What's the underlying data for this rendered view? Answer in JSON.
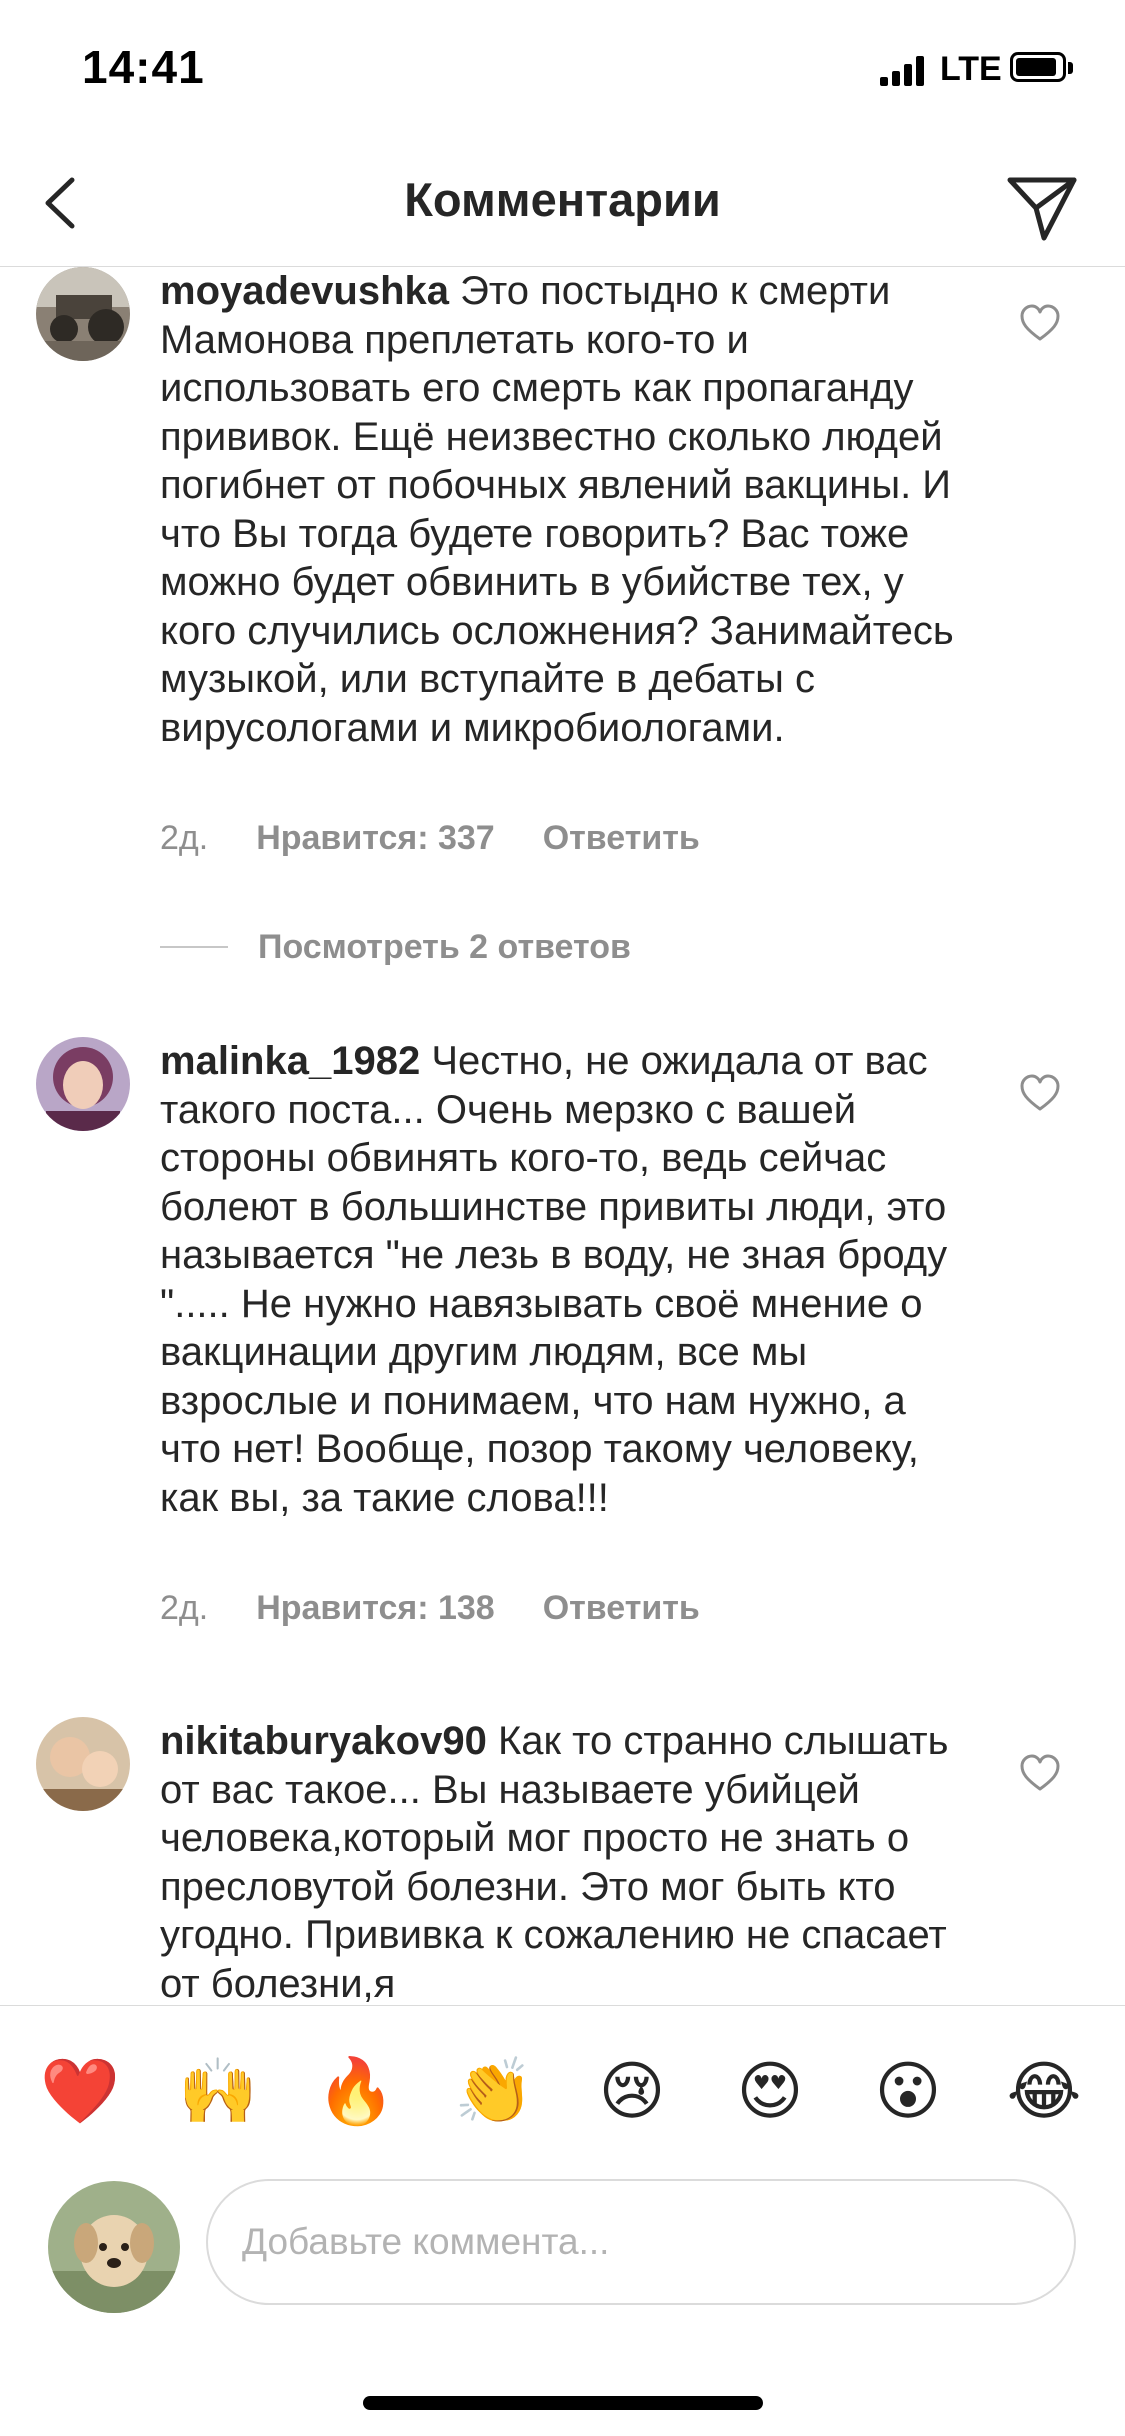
{
  "status": {
    "time": "14:41",
    "network": "LTE"
  },
  "header": {
    "title": "Комментарии"
  },
  "comments": [
    {
      "username": "moyadevushka",
      "text": "Это постыдно к смерти Мамонова преплетать кого-то и использовать его смерть как пропаганду прививок. Ещё неизвестно сколько людей погибнет от побочных явлений вакцины. И что Вы тогда будете говорить? Вас тоже можно будет обвинить в убийстве тех, у кого случились осложнения? Занимайтесь музыкой, или вступайте в дебаты с вирусологами и микробиологами.",
      "age": "2д.",
      "likes": "Нравится: 337",
      "reply": "Ответить",
      "view_replies": "Посмотреть 2 ответов"
    },
    {
      "username": "malinka_1982",
      "text": "Честно, не ожидала от вас такого поста... Очень мерзко с вашей стороны обвинять кого-то, ведь сейчас болеют в большинстве привиты люди, это называется \"не лезь в воду, не зная броду \"..... Не нужно навязывать своё мнение о вакцинации другим людям, все мы взрослые и понимаем, что нам нужно, а что нет! Вообще, позор такому человеку, как вы, за такие слова!!!",
      "age": "2д.",
      "likes": "Нравится: 138",
      "reply": "Ответить"
    },
    {
      "username": "nikitaburyakov90",
      "text": "Как то странно слышать от вас такое... Вы называете убийцей человека,который мог просто не знать о пресловутой болезни. Это мог быть кто угодно. Прививка к сожалению не спасает от болезни,я"
    }
  ],
  "emoji_bar": [
    {
      "glyph": "❤️",
      "name": "heart-emoji"
    },
    {
      "glyph": "🙌",
      "name": "raised-hands-emoji"
    },
    {
      "glyph": "🔥",
      "name": "fire-emoji"
    },
    {
      "glyph": "👏",
      "name": "clapping-hands-emoji"
    },
    {
      "glyph": "😢",
      "name": "crying-face-emoji"
    },
    {
      "glyph": "😍",
      "name": "heart-eyes-emoji"
    },
    {
      "glyph": "😮",
      "name": "surprised-face-emoji"
    },
    {
      "glyph": "😂",
      "name": "tears-of-joy-emoji"
    }
  ],
  "composer": {
    "placeholder": "Добавьте коммента..."
  },
  "icons": {
    "back": "chevron-left-icon",
    "send": "paper-plane-icon",
    "like": "heart-outline-icon"
  },
  "colors": {
    "text": "#262626",
    "secondary": "#8e8e8e",
    "divider": "#dbdbdb"
  }
}
